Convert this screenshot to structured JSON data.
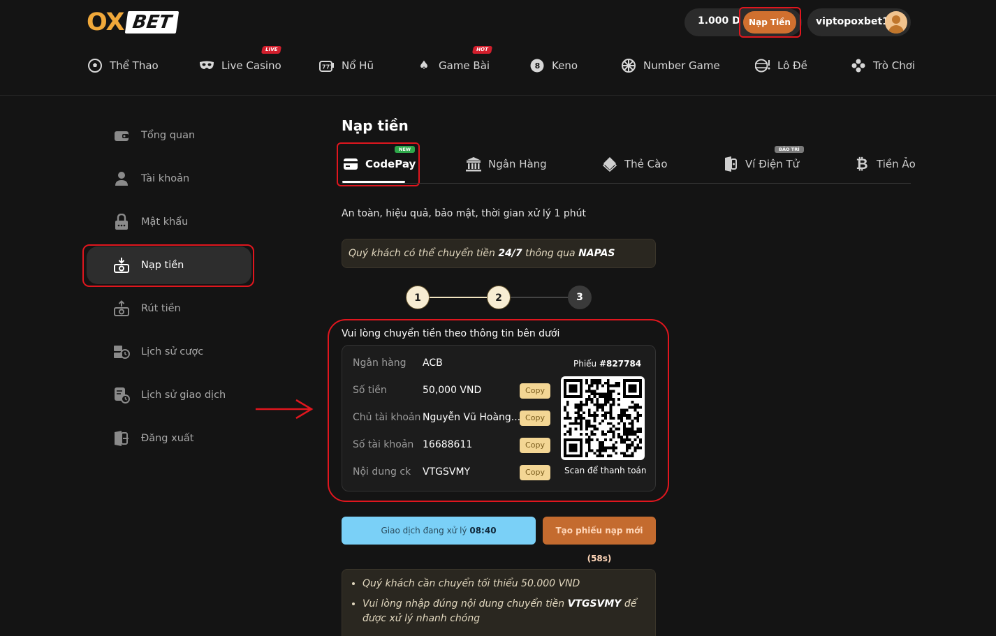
{
  "header": {
    "logo": {
      "part1": "OX",
      "part2": "BET"
    },
    "balance": "1.000 D",
    "deposit_button": "Nạp Tiền",
    "username": "viptopoxbet1"
  },
  "nav": {
    "items": [
      {
        "label": "Thể Thao",
        "icon": "soccer-ball-icon"
      },
      {
        "label": "Live Casino",
        "icon": "mask-icon",
        "badge": "LIVE"
      },
      {
        "label": "Nổ Hũ",
        "icon": "slot-machine-icon"
      },
      {
        "label": "Game Bài",
        "icon": "spade-icon",
        "badge": "HOT"
      },
      {
        "label": "Keno",
        "icon": "eight-ball-icon"
      },
      {
        "label": "Number Game",
        "icon": "wheel-icon"
      },
      {
        "label": "Lô Đề",
        "icon": "lottery-icon"
      },
      {
        "label": "Trò Chơi",
        "icon": "gamepad-icon"
      }
    ]
  },
  "sidebar": {
    "items": [
      {
        "label": "Tổng quan",
        "icon": "wallet-icon"
      },
      {
        "label": "Tài khoản",
        "icon": "user-icon"
      },
      {
        "label": "Mật khẩu",
        "icon": "lock-icon"
      },
      {
        "label": "Nạp tiền",
        "icon": "deposit-icon",
        "active": true
      },
      {
        "label": "Rút tiền",
        "icon": "withdraw-icon"
      },
      {
        "label": "Lịch sử cược",
        "icon": "bet-history-icon"
      },
      {
        "label": "Lịch sử giao dịch",
        "icon": "transaction-history-icon"
      },
      {
        "label": "Đăng xuất",
        "icon": "logout-icon"
      }
    ]
  },
  "main": {
    "title": "Nạp tiền",
    "tabs": [
      {
        "label": "CodePay",
        "icon": "card-icon",
        "badge": "NEW",
        "active": true
      },
      {
        "label": "Ngân Hàng",
        "icon": "bank-icon"
      },
      {
        "label": "Thẻ Cào",
        "icon": "scratch-card-icon"
      },
      {
        "label": "Ví Điện Tử",
        "icon": "e-wallet-icon",
        "badge": "BẢO TRÌ"
      },
      {
        "label": "Tiền Ảo",
        "icon": "bitcoin-icon"
      }
    ],
    "subtitle": "An toàn, hiệu quả, bảo mật, thời gian xử lý 1 phút",
    "notice": {
      "pre": "Quý khách có thể chuyển tiền ",
      "highlight": "24/7",
      "mid": " thông qua ",
      "brand": "NAPAS"
    },
    "steps": [
      "1",
      "2",
      "3"
    ],
    "info_heading": "Vui lòng chuyển tiền theo thông tin bên dưới",
    "info": [
      {
        "label": "Ngân hàng",
        "value": "ACB"
      },
      {
        "label": "Số tiền",
        "value": "50,000 VND",
        "copy": "Copy"
      },
      {
        "label": "Chủ tài khoản",
        "value": "Nguyễn Vũ Hoàng...",
        "copy": "Copy"
      },
      {
        "label": "Số tài khoản",
        "value": "16688611",
        "copy": "Copy"
      },
      {
        "label": "Nội dung ck",
        "value": "VTGSVMY",
        "copy": "Copy"
      }
    ],
    "ticket": {
      "label": "Phiếu ",
      "number": "#827784"
    },
    "scan_text": "Scan để thanh toán",
    "status": {
      "label": "Giao dịch đang xử lý ",
      "timer": "08:40"
    },
    "new_ticket_button": "Tạo phiếu nạp mới (58s)",
    "notes": [
      {
        "text": "Quý khách cần chuyển tối thiểu 50.000 VND"
      },
      {
        "pre": "Vui lòng nhập đúng nội dung chuyển tiền ",
        "code": "VTGSVMY",
        "post": " để được xử lý nhanh chóng"
      }
    ]
  },
  "colors": {
    "accent": "#d0702f",
    "highlight": "#e0161e",
    "status": "#7ad0f7",
    "gold": "#f3d694"
  }
}
